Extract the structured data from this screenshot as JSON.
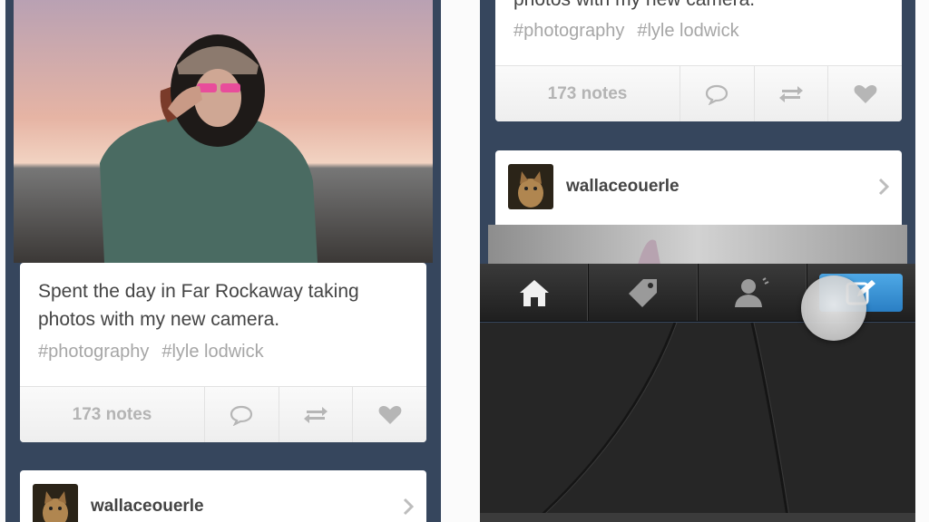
{
  "left_screen": {
    "post": {
      "caption": "Spent the day in Far Rockaway taking photos with my new camera.",
      "tags": [
        "#photography",
        "#lyle lodwick"
      ],
      "notes": "173 notes"
    },
    "next_post": {
      "username": "wallaceouerle"
    }
  },
  "right_screen": {
    "post": {
      "caption_tail": "photos with my new camera.",
      "tags": [
        "#photography",
        "#lyle lodwick"
      ],
      "notes": "173 notes"
    },
    "next_post": {
      "username": "wallaceouerle"
    },
    "tabbar": {
      "tabs": [
        "home-icon",
        "tag-icon",
        "account-icon",
        "compose-icon"
      ],
      "accent": "#3b8fd4"
    }
  },
  "colors": {
    "dashboard_bg": "#36465d",
    "card": "#ffffff",
    "tag_text": "#a6a6a6"
  }
}
